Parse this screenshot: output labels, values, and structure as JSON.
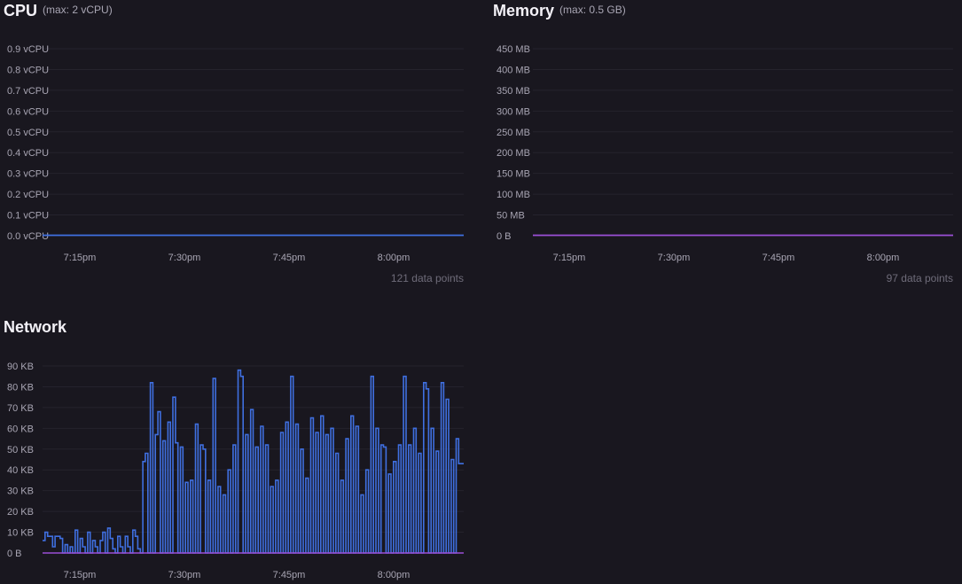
{
  "panels": {
    "cpu": {
      "title": "CPU",
      "subtitle": "(max: 2 vCPU)",
      "footnote": "121 data points"
    },
    "memory": {
      "title": "Memory",
      "subtitle": "(max: 0.5 GB)",
      "footnote": "97 data points"
    },
    "network": {
      "title": "Network"
    }
  },
  "colors": {
    "background": "#19171f",
    "cpu_line": "#3f6fe0",
    "memory_line": "#9b4fd6",
    "network_in": "#3f6fe0",
    "network_out": "#9b4fd6",
    "grid": "#25232d"
  },
  "chart_data": [
    {
      "id": "cpu",
      "type": "line",
      "title": "CPU",
      "y_ticks": [
        "0.0 vCPU",
        "0.1 vCPU",
        "0.2 vCPU",
        "0.3 vCPU",
        "0.4 vCPU",
        "0.5 vCPU",
        "0.6 vCPU",
        "0.7 vCPU",
        "0.8 vCPU",
        "0.9 vCPU"
      ],
      "ylim": [
        0,
        0.9
      ],
      "x_ticks": [
        "7:15pm",
        "7:30pm",
        "7:45pm",
        "8:00pm"
      ],
      "grid": true,
      "series": [
        {
          "color": "#3f6fe0",
          "values": [
            0.002,
            0.002
          ]
        }
      ]
    },
    {
      "id": "memory",
      "type": "line",
      "title": "Memory",
      "y_ticks": [
        "0 B",
        "50 MB",
        "100 MB",
        "150 MB",
        "200 MB",
        "250 MB",
        "300 MB",
        "350 MB",
        "400 MB",
        "450 MB"
      ],
      "ylim": [
        0,
        450
      ],
      "x_ticks": [
        "7:15pm",
        "7:30pm",
        "7:45pm",
        "8:00pm"
      ],
      "grid": true,
      "series": [
        {
          "color": "#9b4fd6",
          "values": [
            1,
            1
          ]
        }
      ]
    },
    {
      "id": "network",
      "type": "line",
      "title": "Network",
      "y_ticks": [
        "0 B",
        "10 KB",
        "20 KB",
        "30 KB",
        "40 KB",
        "50 KB",
        "60 KB",
        "70 KB",
        "80 KB",
        "90 KB"
      ],
      "ylim": [
        0,
        90
      ],
      "x_ticks": [
        "7:15pm",
        "7:30pm",
        "7:45pm",
        "8:00pm"
      ],
      "grid": true,
      "series": [
        {
          "color": "#3f6fe0",
          "step": true,
          "values": [
            6,
            10,
            8,
            8,
            3,
            8,
            8,
            7,
            0,
            4,
            0,
            3,
            0,
            11,
            0,
            7,
            3,
            0,
            10,
            0,
            6,
            3,
            0,
            6,
            10,
            0,
            12,
            7,
            2,
            0,
            8,
            3,
            0,
            8,
            3,
            0,
            11,
            8,
            2,
            0,
            44,
            48,
            0,
            82,
            0,
            57,
            68,
            0,
            54,
            0,
            63,
            0,
            75,
            53,
            0,
            51,
            0,
            34,
            0,
            35,
            0,
            62,
            0,
            52,
            50,
            0,
            35,
            0,
            84,
            0,
            32,
            0,
            28,
            0,
            40,
            0,
            52,
            0,
            88,
            85,
            0,
            57,
            0,
            69,
            0,
            51,
            0,
            61,
            0,
            52,
            0,
            32,
            0,
            35,
            0,
            58,
            0,
            63,
            0,
            85,
            0,
            62,
            0,
            50,
            0,
            36,
            0,
            65,
            0,
            58,
            0,
            66,
            0,
            57,
            0,
            60,
            0,
            48,
            0,
            35,
            0,
            55,
            0,
            66,
            0,
            61,
            0,
            28,
            0,
            40,
            0,
            85,
            0,
            60,
            0,
            52,
            51,
            0,
            38,
            0,
            44,
            0,
            52,
            0,
            85,
            0,
            52,
            0,
            60,
            0,
            48,
            0,
            82,
            79,
            0,
            60,
            0,
            49,
            0,
            82,
            0,
            74,
            0,
            45,
            0,
            55,
            43,
            43
          ]
        },
        {
          "color": "#9b4fd6",
          "step": true,
          "values": [
            0,
            0
          ]
        }
      ]
    }
  ]
}
